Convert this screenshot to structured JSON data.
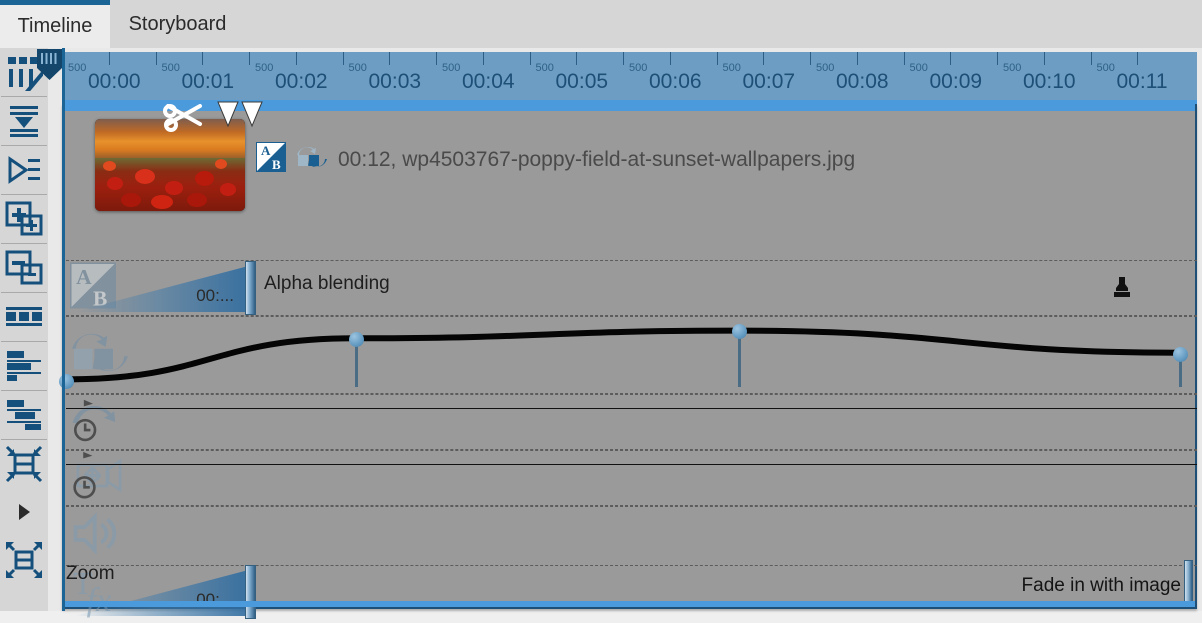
{
  "tabs": [
    {
      "label": "Timeline",
      "active": true
    },
    {
      "label": "Storyboard",
      "active": false
    }
  ],
  "toolbar": {
    "items": [
      {
        "name": "split-all-icon",
        "tip": "Split / cut markers"
      },
      {
        "name": "align-center-icon",
        "tip": "Center alignment"
      },
      {
        "name": "align-right-icon",
        "tip": "Right alignment"
      },
      {
        "name": "add-clip-icon",
        "tip": "Add clip"
      },
      {
        "name": "remove-clip-icon",
        "tip": "Remove clip"
      },
      {
        "name": "filmstrip-icon",
        "tip": "Filmstrip view"
      },
      {
        "name": "stagger-top-icon",
        "tip": "Stagger top"
      },
      {
        "name": "stagger-bottom-icon",
        "tip": "Stagger bottom"
      },
      {
        "name": "zoom-fit-in-icon",
        "tip": "Zoom to fit"
      },
      {
        "name": "play-icon",
        "tip": "Play"
      },
      {
        "name": "zoom-fit-out-icon",
        "tip": "Zoom out to fit"
      }
    ]
  },
  "ruler": {
    "seconds": [
      "00:00",
      "00:01",
      "00:02",
      "00:03",
      "00:04",
      "00:05",
      "00:06",
      "00:07",
      "00:08",
      "00:09",
      "00:10",
      "00:11"
    ],
    "half_label": "500",
    "playhead_time": "00:00"
  },
  "clip": {
    "duration": "00:12",
    "filename": "wp4503767-poppy-field-at-sunset-wallpapers.jpg",
    "meta_text": "00:12, wp4503767-poppy-field-at-sunset-wallpapers.jpg",
    "blend_icon": "alpha-blend-ab-icon",
    "transform_icon": "transition-icon"
  },
  "tracks": [
    {
      "name": "alpha-blending",
      "label": "Alpha blending",
      "icon": "alpha-blend-ab-icon",
      "ramp_label": "00:...",
      "right_icon": "stamp-icon"
    },
    {
      "name": "transition-curve",
      "label": "",
      "icon": "transition-icon",
      "ramp_label": ""
    },
    {
      "name": "rotation-keyframes",
      "label": "",
      "icon": "rotation-clock-icon",
      "ramp_label": ""
    },
    {
      "name": "pan-keyframes",
      "label": "",
      "icon": "pan-clock-icon",
      "ramp_label": ""
    },
    {
      "name": "audio-volume",
      "label": "",
      "icon": "speaker-icon",
      "ramp_label": ""
    },
    {
      "name": "zoom-track",
      "label": "Zoom",
      "icon": "text-fx-icon",
      "ramp_label": "00:...",
      "note": "Fade in with image"
    }
  ],
  "curve": {
    "type": "line",
    "keyframes": [
      {
        "x_pct": 0.0,
        "y_pct": 82
      },
      {
        "x_pct": 25.6,
        "y_pct": 28
      },
      {
        "x_pct": 59.5,
        "y_pct": 18
      },
      {
        "x_pct": 98.5,
        "y_pct": 47
      }
    ]
  },
  "colors": {
    "accent_blue": "#1a6496",
    "selection_blue": "#4a9adc",
    "ruler_blue": "#6d9dc2",
    "track_gray": "#9a9a9a",
    "rail_gray": "#d6d6d6"
  }
}
